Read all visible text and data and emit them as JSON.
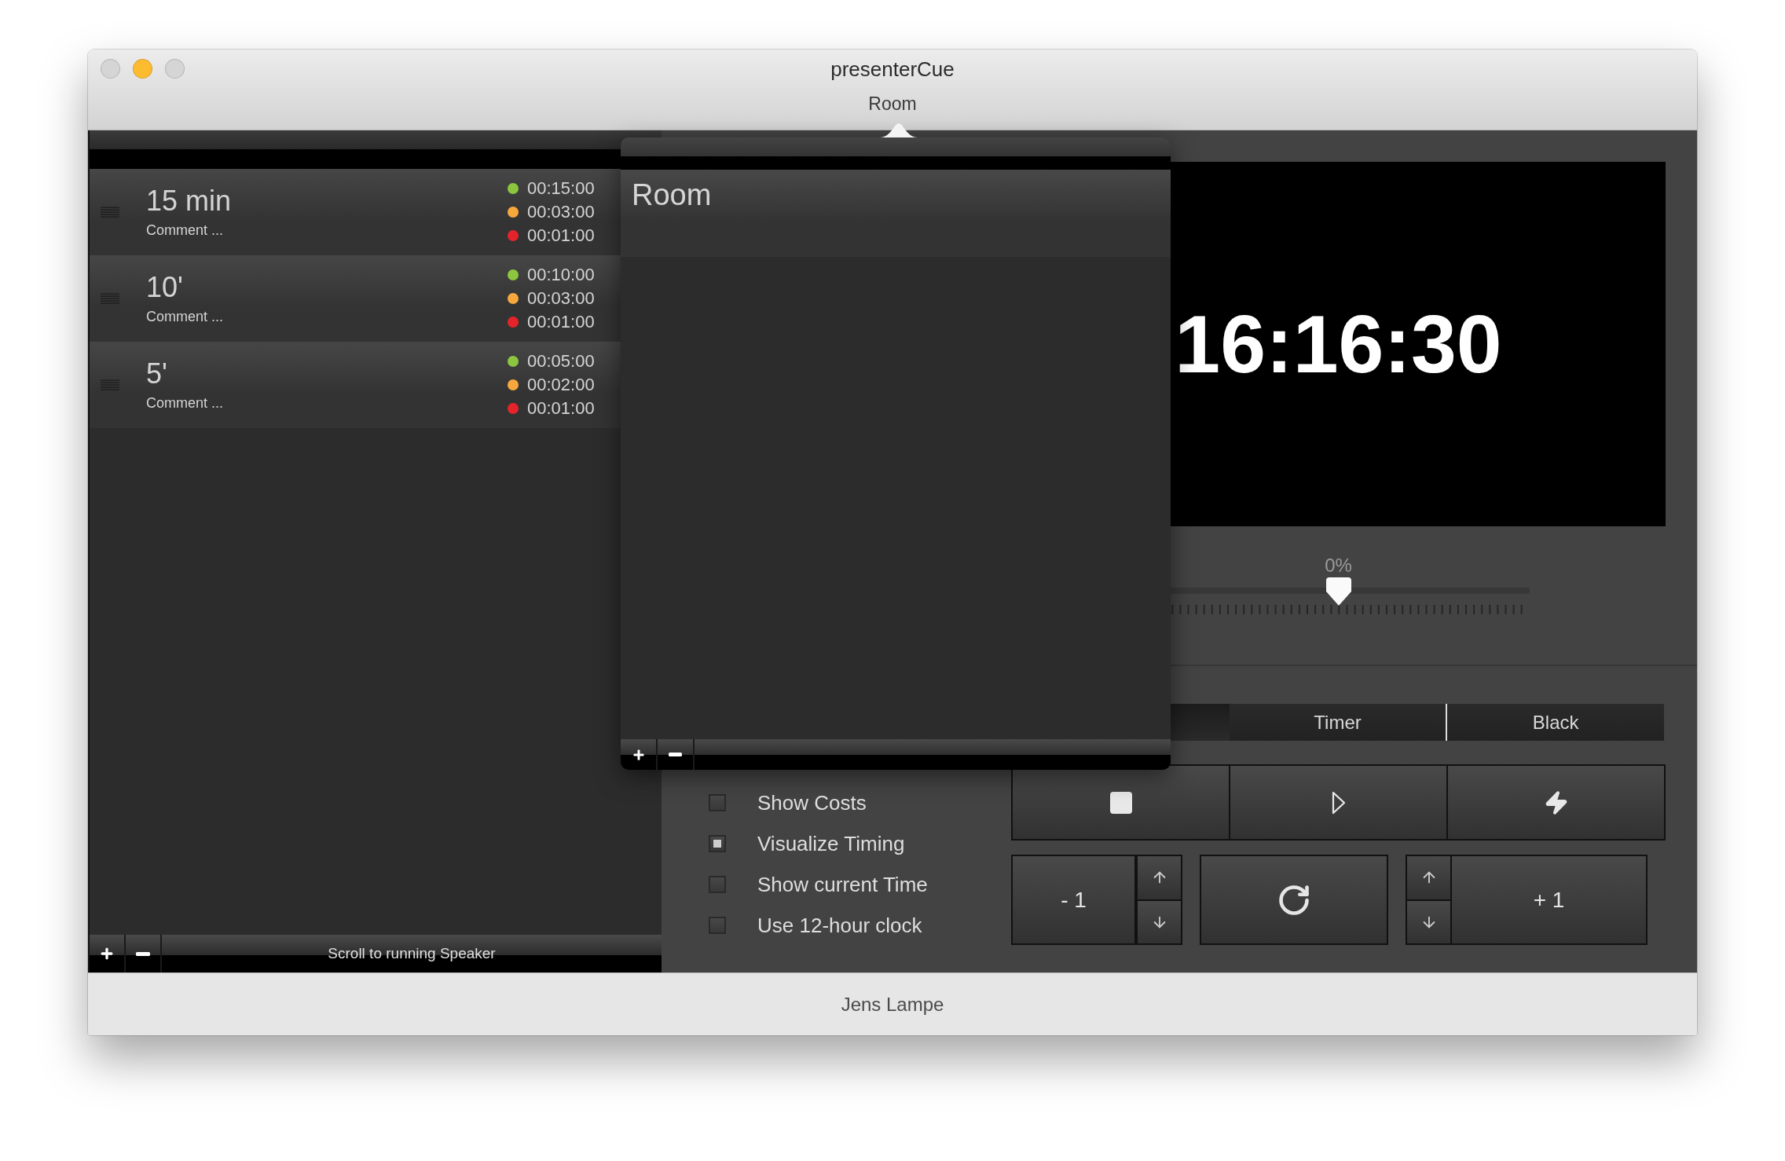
{
  "window": {
    "title": "presenterCue"
  },
  "toolbar": {
    "label": "Room"
  },
  "speakers": [
    {
      "title": "15 min",
      "comment": "Comment ...",
      "times": [
        {
          "value": "00:15:00",
          "color": "#8cc63f"
        },
        {
          "value": "00:03:00",
          "color": "#f7a83c"
        },
        {
          "value": "00:01:00",
          "color": "#e5232b"
        }
      ]
    },
    {
      "title": "10'",
      "comment": "Comment ...",
      "times": [
        {
          "value": "00:10:00",
          "color": "#8cc63f"
        },
        {
          "value": "00:03:00",
          "color": "#f7a83c"
        },
        {
          "value": "00:01:00",
          "color": "#e5232b"
        }
      ]
    },
    {
      "title": "5'",
      "comment": "Comment ...",
      "times": [
        {
          "value": "00:05:00",
          "color": "#8cc63f"
        },
        {
          "value": "00:02:00",
          "color": "#f7a83c"
        },
        {
          "value": "00:01:00",
          "color": "#e5232b"
        }
      ]
    }
  ],
  "speakers_bar": {
    "scroll_button": "Scroll to running Speaker"
  },
  "rooms_popover": {
    "rooms": [
      {
        "name": "Room"
      }
    ]
  },
  "preview": {
    "clock": "16:16:30"
  },
  "offset_slider": {
    "reading": "0%",
    "level": 0.5
  },
  "segments": [
    {
      "selected": true
    },
    {
      "label": "Timer",
      "selected": false
    },
    {
      "label": "Black",
      "selected": false
    }
  ],
  "options": [
    {
      "label": "Show Costs",
      "checked": false
    },
    {
      "label": "Visualize Timing",
      "checked": true
    },
    {
      "label": "Show current Time",
      "checked": false
    },
    {
      "label": "Use 12-hour clock",
      "checked": false
    }
  ],
  "controls": {
    "minus_one": "- 1",
    "plus_one": "+ 1"
  },
  "status_bar": {
    "text": "Jens Lampe"
  }
}
